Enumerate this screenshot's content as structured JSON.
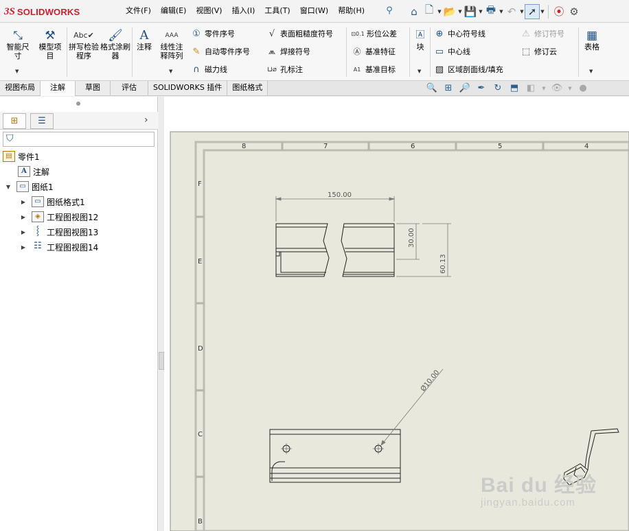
{
  "app": {
    "logo_prefix": "3S",
    "logo_text": "SOLIDWORKS"
  },
  "menu": [
    "文件(F)",
    "编辑(E)",
    "视图(V)",
    "插入(I)",
    "工具(T)",
    "窗口(W)",
    "帮助(H)"
  ],
  "ribbon": {
    "smart_dim": "智能尺寸",
    "model_items": "模型项目",
    "spell_check": "拼写检验程序",
    "format_painter": "格式涂刷器",
    "note": "注释",
    "linear_pattern": "线性注释阵列",
    "balloon": "零件序号",
    "auto_balloon": "自动零件序号",
    "magnetic_line": "磁力线",
    "surface_finish": "表面粗糙度符号",
    "weld_symbol": "焊接符号",
    "hole_callout": "孔标注",
    "gtol": "形位公差",
    "datum_feature": "基准特征",
    "datum_target": "基准目标",
    "block": "块",
    "center_mark": "中心符号线",
    "centerline": "中心线",
    "hatch": "区域剖面线/填充",
    "revision_symbol": "修订符号",
    "revision_cloud": "修订云",
    "table": "表格",
    "gtol_icon_text": "⊡0.1",
    "datum_target_icon_text": "A1"
  },
  "tabs": [
    "视图布局",
    "注解",
    "草图",
    "评估",
    "SOLIDWORKS 插件",
    "图纸格式"
  ],
  "active_tab": "注解",
  "tree": {
    "root": "零件1",
    "annotations": "注解",
    "sheet": "图纸1",
    "sheet_format": "图纸格式1",
    "view12": "工程图视图12",
    "view13": "工程图视图13",
    "view14": "工程图视图14"
  },
  "sheet": {
    "col_labels": [
      "8",
      "7",
      "6",
      "5",
      "4"
    ],
    "row_labels": [
      "F",
      "E",
      "D",
      "C",
      "B"
    ],
    "dims": {
      "width": "150.00",
      "height1": "30.00",
      "height2": "60.13",
      "hole": "Ø10.00"
    }
  },
  "watermark": {
    "line1": "Bai du 经验",
    "line2": "jingyan.baidu.com"
  },
  "colors": {
    "sheet_bg": "#e9e8dc",
    "brand_red": "#d0202b",
    "accent_blue": "#1f4f86"
  }
}
